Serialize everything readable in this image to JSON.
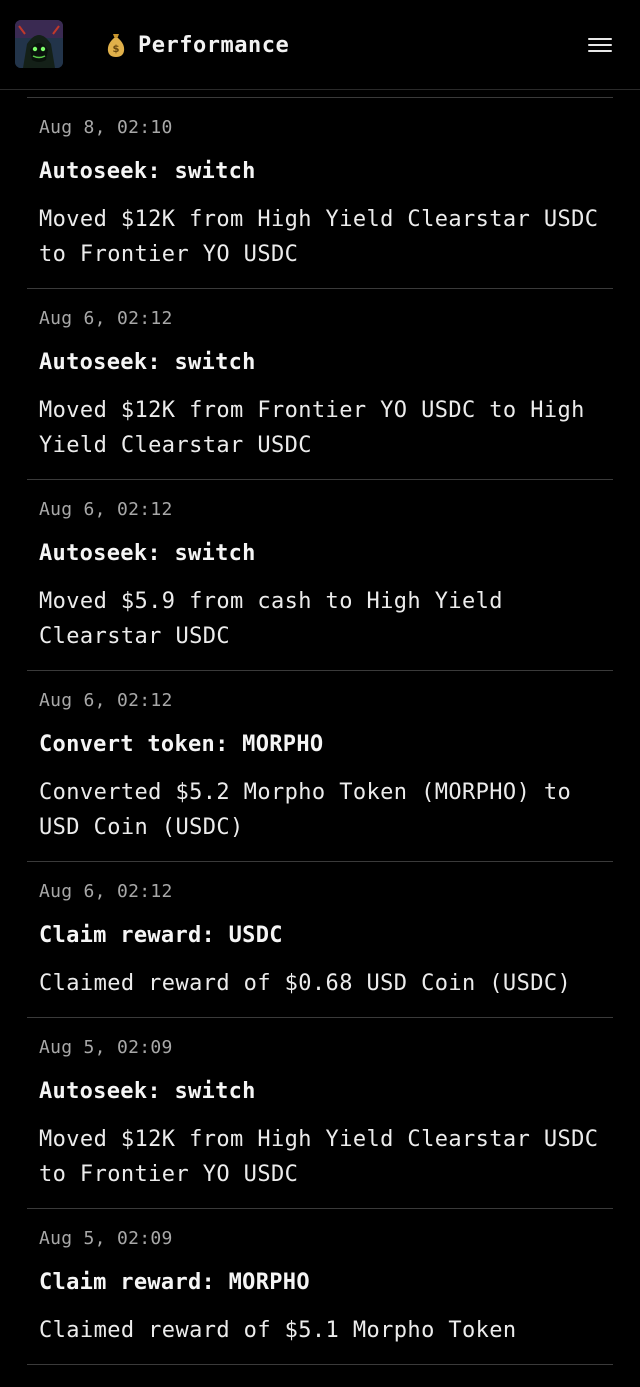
{
  "header": {
    "title": "Performance",
    "title_icon": "money-bag-icon",
    "avatar_icon": "hooded-figure-avatar",
    "menu_icon": "hamburger-menu-icon"
  },
  "activity": [
    {
      "time": "Aug 8, 02:10",
      "title": "Autoseek: switch",
      "description": "Moved $12K from High Yield Clearstar USDC to Frontier YO USDC"
    },
    {
      "time": "Aug 6, 02:12",
      "title": "Autoseek: switch",
      "description": "Moved $12K from Frontier YO USDC to High Yield Clearstar USDC"
    },
    {
      "time": "Aug 6, 02:12",
      "title": "Autoseek: switch",
      "description": "Moved $5.9 from cash to High Yield Clearstar USDC"
    },
    {
      "time": "Aug 6, 02:12",
      "title": "Convert token: MORPHO",
      "description": "Converted $5.2 Morpho Token (MORPHO) to USD Coin (USDC)"
    },
    {
      "time": "Aug 6, 02:12",
      "title": "Claim reward: USDC",
      "description": "Claimed reward of $0.68 USD Coin (USDC)"
    },
    {
      "time": "Aug 5, 02:09",
      "title": "Autoseek: switch",
      "description": "Moved $12K from High Yield Clearstar USDC to Frontier YO USDC"
    },
    {
      "time": "Aug 5, 02:09",
      "title": "Claim reward: MORPHO",
      "description": "Claimed reward of $5.1 Morpho Token"
    }
  ],
  "colors": {
    "background": "#000000",
    "divider": "#3a3a3a",
    "text_primary": "#f5f5f5",
    "text_secondary": "#a8a8a8"
  }
}
